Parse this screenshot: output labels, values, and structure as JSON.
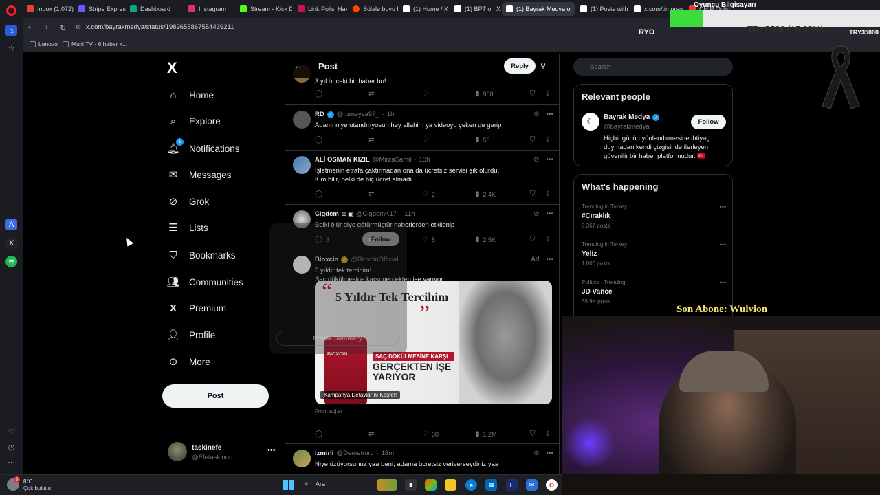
{
  "browser": {
    "tabs": [
      {
        "label": "Inbox (1,072) -",
        "color": "#ea4335"
      },
      {
        "label": "Stripe Express",
        "color": "#635bff"
      },
      {
        "label": "Dashboard",
        "color": "#10a37f"
      },
      {
        "label": "Instagram",
        "color": "#e1306c"
      },
      {
        "label": "Stream - Kick D",
        "color": "#53fc18"
      },
      {
        "label": "Link Polisi Hak",
        "color": "#c2185b"
      },
      {
        "label": "Sülale boyu ha",
        "color": "#ff4500"
      },
      {
        "label": "(1) Home / X",
        "color": "#ffffff"
      },
      {
        "label": "(1) BPT on X: \"",
        "color": "#ffffff"
      },
      {
        "label": "(1) Bayrak Medya on X: \"",
        "color": "#ffffff"
      },
      {
        "label": "(1) Posts with",
        "color": "#ffffff"
      },
      {
        "label": "x.com/timursp",
        "color": "#ffffff"
      },
      {
        "label": "CHIP Onlin",
        "color": "#e53935"
      }
    ],
    "url": "x.com/bayrakmedya/status/1989655867554439211",
    "bookmarks": [
      "Lenovo",
      "Multi TV - 6 haber k..."
    ]
  },
  "nav": {
    "logo": "X",
    "notif_count": "1",
    "items": {
      "home": "Home",
      "explore": "Explore",
      "notifications": "Notifications",
      "messages": "Messages",
      "grok": "Grok",
      "lists": "Lists",
      "bookmarks": "Bookmarks",
      "communities": "Communities",
      "premium": "Premium",
      "profile": "Profile",
      "more": "More"
    },
    "post_button": "Post",
    "account": {
      "name": "taskinefe",
      "handle": "@Efetaskinnn"
    }
  },
  "timeline": {
    "header": {
      "title": "Post",
      "reply_button": "Reply"
    },
    "partial_text": "3 yıl önceki bir haber bu!",
    "partial_views": "968",
    "tweets": [
      {
        "name": "RD",
        "handle": "@rumeysa97_",
        "time": "1h",
        "text": "Adamı niye utandırıyosun hey allahim ya videoyu çeken de garip",
        "replies": "",
        "retweets": "",
        "likes": "",
        "views": "50"
      },
      {
        "name": "ALİ OSMAN KIZIL",
        "handle": "@MirzaSamil",
        "time": "10h",
        "text": "İşletmenin etrafa çaktırmadan ona da ücretsiz servisi şık olurdu.\nKim bilir, belki de hiç ücret almadı.",
        "replies": "",
        "retweets": "",
        "likes": "2",
        "views": "2.4K"
      },
      {
        "name": "Cigdem",
        "handle": "@CigdemK17",
        "time": "11h",
        "text": "Belki ölür diye götürmüştür haberlerden etkilenip",
        "replies": "3",
        "retweets": "",
        "likes": "5",
        "views": "2.5K"
      },
      {
        "name": "izmirli",
        "handle": "@Demetrnrc",
        "time": "18m",
        "text": "Niye üzüyorsunuz yaa beni, adama ücretsiz veriverseydiniz yaa"
      }
    ],
    "ad": {
      "name": "Bioxcin",
      "handle": "@BioxcinOfficial",
      "label": "Ad",
      "text": "5 yıldır tek tercihim!\nSaç dökülmesine karşı gerçekten işe yarıyor.",
      "image_headline": "5 Yıldır Tek Tercihim",
      "bottle_label": "BIOXCIN",
      "slogan_top": "SAÇ DÖKÜLMESİNE KARŞI",
      "slogan_main": "GERÇEKTEN İŞE YARIYOR",
      "cta": "Kampanya Detaylarını Keşfet!",
      "from": "From adj.st",
      "likes": "30",
      "views": "1.2M"
    },
    "hover_card": {
      "follow": "Follow",
      "profile_summary": "Profile Summary"
    }
  },
  "right": {
    "search_placeholder": "Search",
    "relevant": {
      "title": "Relevant people",
      "name": "Bayrak Medya",
      "handle": "@bayrakmedya",
      "follow": "Follow",
      "bio": "Hiçbir gücün yönlendirmesine ihtiyaç duymadan kendi çizgisinde ilerleyen güvenilir bir haber platformudur. 🇹🇷"
    },
    "happening": {
      "title": "What's happening",
      "trends": [
        {
          "context": "Trending in Turkey",
          "title": "#Çıraklık",
          "posts": "8,367 posts"
        },
        {
          "context": "Trending in Turkey",
          "title": "Yeliz",
          "posts": "1,000 posts"
        },
        {
          "context": "Politics · Trending",
          "title": "JD Vance",
          "posts": "65.9K posts"
        }
      ]
    }
  },
  "overlay": {
    "goal_title": "Oyuncu Bilgisayarı",
    "goal_text": "TRY5536 (15.82%)",
    "goal_progress": 0.1582,
    "left_label": "RYO",
    "right_label": "TRY35000",
    "last_sub": "Son Abone: Wulvion"
  },
  "taskbar": {
    "weather_temp": "8°C",
    "weather_desc": "Çok bulutlu",
    "weather_badge": "9",
    "search": "Ara"
  }
}
